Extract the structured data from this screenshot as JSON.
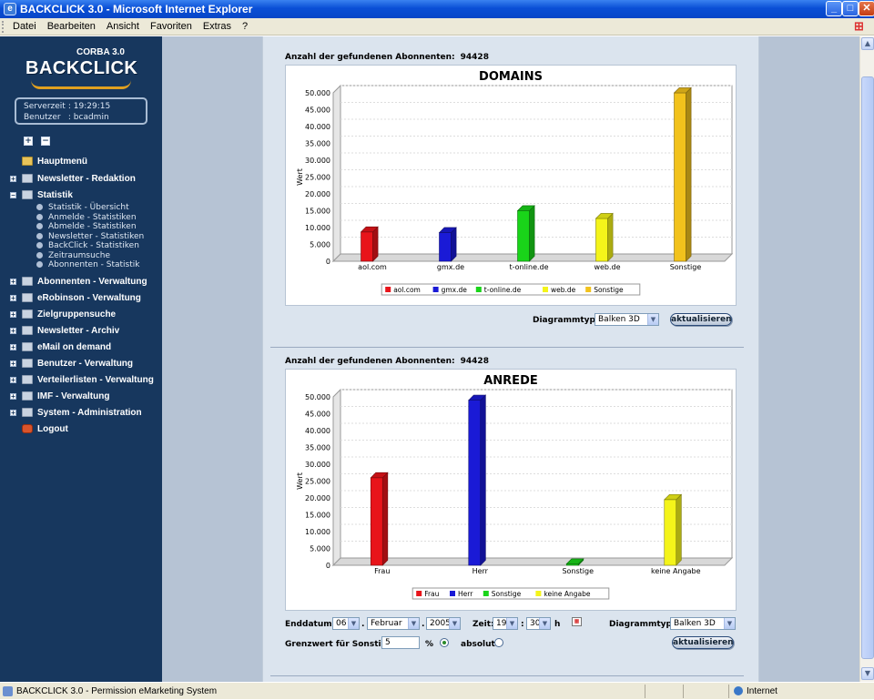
{
  "window": {
    "title": "BACKCLICK 3.0 - Microsoft Internet Explorer",
    "buttons": {
      "minimize": "_",
      "maximize": "□",
      "close": "✕"
    }
  },
  "menu": {
    "items": [
      "Datei",
      "Bearbeiten",
      "Ansicht",
      "Favoriten",
      "Extras",
      "?"
    ]
  },
  "sidebar": {
    "logo_top": "CORBA 3.0",
    "logo_main": "BACKCLICK",
    "server": {
      "time_label": "Serverzeit",
      "time_sep": ":",
      "time_value": "19:29:15",
      "user_label": "Benutzer",
      "user_sep": ":",
      "user_value": "bcadmin"
    },
    "expand_all": "+",
    "collapse_all": "−",
    "nav": {
      "hauptmenu": "Hauptmenü",
      "redaktion": "Newsletter - Redaktion",
      "statistik": "Statistik",
      "abonnenten": "Abonnenten - Verwaltung",
      "erobinson": "eRobinson - Verwaltung",
      "zielgruppe": "Zielgruppensuche",
      "archiv": "Newsletter - Archiv",
      "emailondemand": "eMail on demand",
      "benutzer": "Benutzer - Verwaltung",
      "verteiler": "Verteilerlisten - Verwaltung",
      "imf": "IMF - Verwaltung",
      "system": "System - Administration",
      "logout": "Logout"
    },
    "statistik_sub": [
      "Statistik - Übersicht",
      "Anmelde - Statistiken",
      "Abmelde - Statistiken",
      "Newsletter - Statistiken",
      "BackClick - Statistiken",
      "Zeitraumsuche",
      "Abonnenten - Statistik"
    ],
    "expander_plus": "+",
    "expander_minus": "−"
  },
  "main": {
    "count_label": "Anzahl der gefundenen Abonnenten:",
    "count_value": "94428",
    "chart_type_label": "Diagrammtyp:",
    "chart_type_value": "Balken 3D",
    "refresh_label": "aktualisieren",
    "enddatum_label": "Enddatum:",
    "day": "06",
    "month": "Februar",
    "year": "2005",
    "zeit_label": "Zeit:",
    "hour": "19",
    "minute": "30",
    "h_label": "h",
    "grenzwert_label": "Grenzwert für Sonstige:",
    "grenzwert_value": "5",
    "percent_label": "%",
    "absolut_label": "absolut",
    "dot": ".",
    "colon": ":",
    "dropdown_arrow": "▼"
  },
  "chart_data": [
    {
      "type": "bar",
      "title": "DOMAINS",
      "ylabel": "Wert",
      "categories": [
        "aol.com",
        "gmx.de",
        "t-online.de",
        "web.de",
        "Sonstige"
      ],
      "values": [
        8700,
        8500,
        15000,
        12700,
        50000
      ],
      "colors": [
        "#e8141a",
        "#1a1ad6",
        "#19d419",
        "#f4f41a",
        "#f2c21c"
      ],
      "ylim": [
        0,
        50000
      ],
      "yticks": [
        "0",
        "5.000",
        "10.000",
        "15.000",
        "20.000",
        "25.000",
        "30.000",
        "35.000",
        "40.000",
        "45.000",
        "50.000"
      ],
      "legend": [
        "aol.com",
        "gmx.de",
        "t-online.de",
        "web.de",
        "Sonstige"
      ],
      "legend_position": "bottom"
    },
    {
      "type": "bar",
      "title": "ANREDE",
      "ylabel": "Wert",
      "categories": [
        "Frau",
        "Herr",
        "Sonstige",
        "keine Angabe"
      ],
      "values": [
        26000,
        49000,
        400,
        19500
      ],
      "colors": [
        "#e8141a",
        "#1a1ad6",
        "#19d419",
        "#f4f41a"
      ],
      "ylim": [
        0,
        50000
      ],
      "yticks": [
        "0",
        "5.000",
        "10.000",
        "15.000",
        "20.000",
        "25.000",
        "30.000",
        "35.000",
        "40.000",
        "45.000",
        "50.000"
      ],
      "legend": [
        "Frau",
        "Herr",
        "Sonstige",
        "keine Angabe"
      ],
      "legend_position": "bottom"
    }
  ],
  "status": {
    "text": "BACKCLICK 3.0 - Permission eMarketing System",
    "zone": "Internet"
  },
  "icons": {
    "app": "ie-icon",
    "home": "home-icon",
    "folder": "folder-icon",
    "logout": "logout-icon"
  }
}
